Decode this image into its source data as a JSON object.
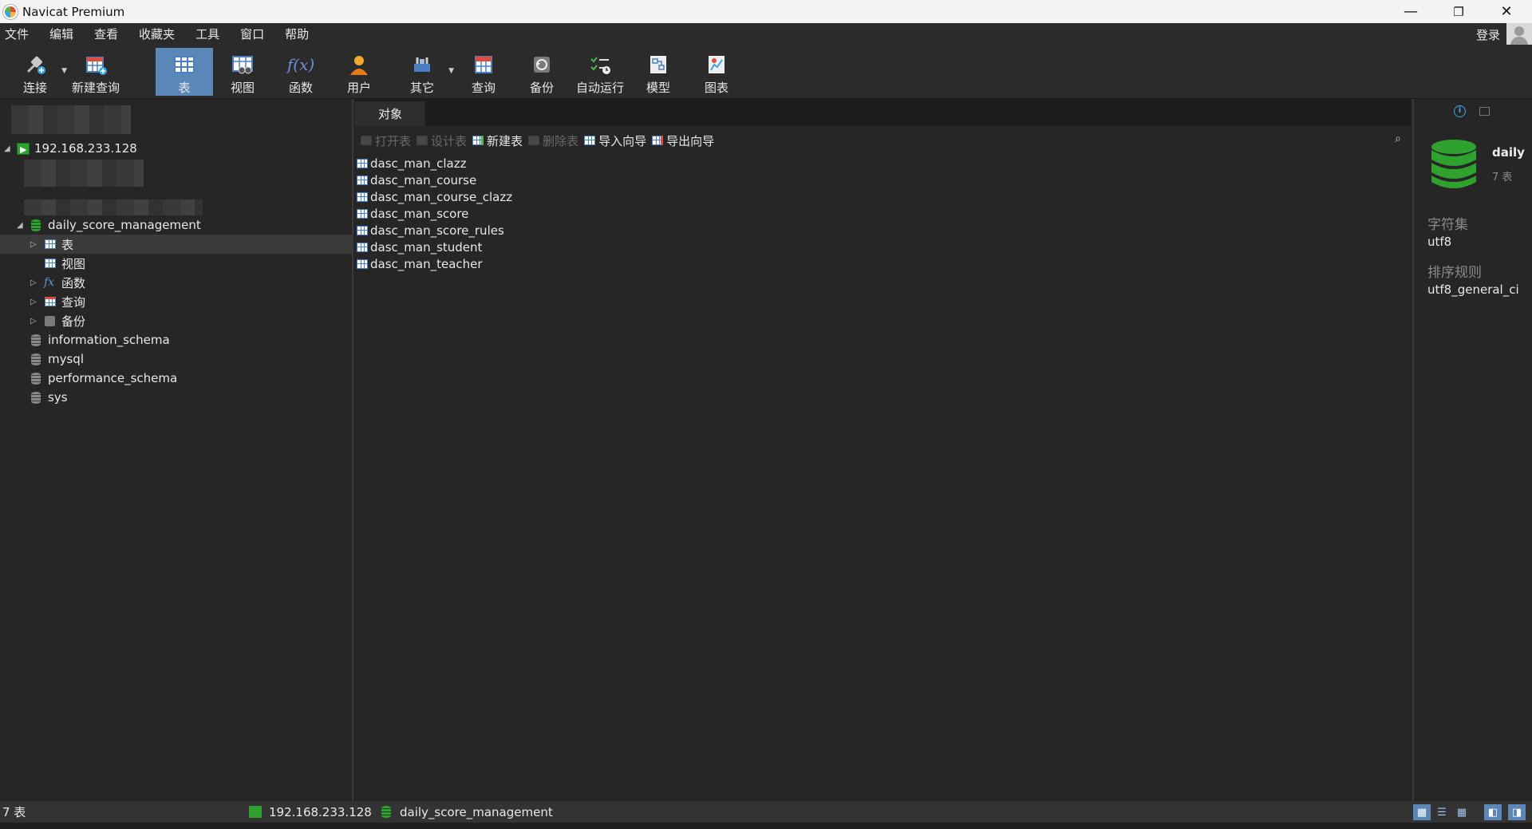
{
  "window": {
    "title": "Navicat Premium",
    "minimize": "—",
    "restore": "❐",
    "close": "✕"
  },
  "menu": {
    "items": [
      "文件",
      "编辑",
      "查看",
      "收藏夹",
      "工具",
      "窗口",
      "帮助"
    ],
    "login": "登录"
  },
  "toolbar": {
    "connect": "连接",
    "new_query": "新建查询",
    "table": "表",
    "view": "视图",
    "function": "函数",
    "user": "用户",
    "other": "其它",
    "query": "查询",
    "backup": "备份",
    "automation": "自动运行",
    "model": "模型",
    "chart": "图表",
    "active": "表"
  },
  "sidebar": {
    "connection": "192.168.233.128",
    "database": "daily_score_management",
    "db_children": [
      "表",
      "视图",
      "函数",
      "查询",
      "备份"
    ],
    "other_dbs": [
      "information_schema",
      "mysql",
      "performance_schema",
      "sys"
    ]
  },
  "main": {
    "tab": "对象",
    "actions": {
      "open": "打开表",
      "design": "设计表",
      "new": "新建表",
      "delete": "删除表",
      "import": "导入向导",
      "export": "导出向导"
    },
    "tables": [
      "dasc_man_clazz",
      "dasc_man_course",
      "dasc_man_course_clazz",
      "dasc_man_score",
      "dasc_man_score_rules",
      "dasc_man_student",
      "dasc_man_teacher"
    ]
  },
  "info": {
    "db_name": "daily",
    "count": "7 表",
    "charset_label": "字符集",
    "charset": "utf8",
    "collation_label": "排序规则",
    "collation": "utf8_general_ci"
  },
  "status": {
    "count": "7 表",
    "connection": "192.168.233.128",
    "database": "daily_score_management"
  },
  "colors": {
    "accent": "#5b87b8",
    "db_green": "#2fa12f",
    "table_blue": "#4a7fc1",
    "background": "#262626"
  }
}
